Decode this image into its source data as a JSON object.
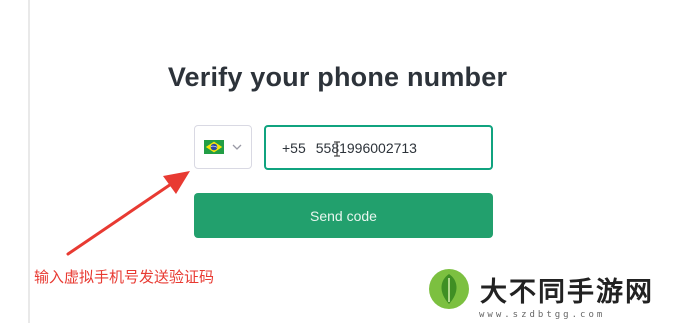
{
  "title": "Verify your phone number",
  "country": {
    "flag_icon": "brazil-flag-icon",
    "chevron_icon": "chevron-down-icon"
  },
  "phone": {
    "country_code": "+55",
    "number": "5581996002713"
  },
  "send_button_label": "Send code",
  "annotation": "输入虚拟手机号发送验证码",
  "watermark": {
    "text": "大不同手游网",
    "url": "www.szdbtgg.com"
  },
  "colors": {
    "accent": "#10a37f",
    "button": "#22a06d",
    "annotation": "#e83a32"
  }
}
